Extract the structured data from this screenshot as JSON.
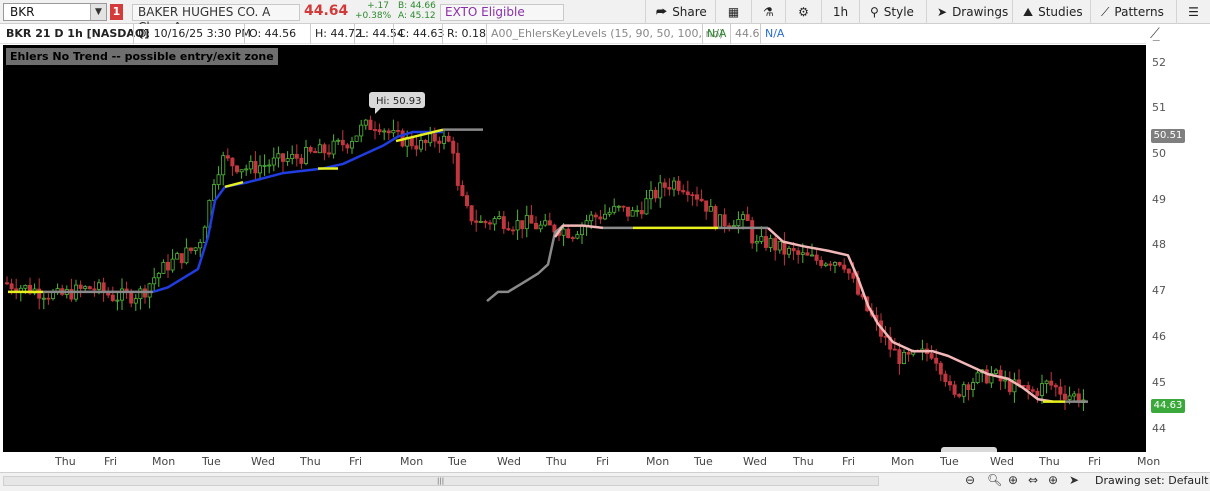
{
  "symbol": {
    "value": "BKR",
    "link_badge": "1"
  },
  "quote": {
    "company": "BAKER HUGHES CO. A Class A",
    "last": "44.64",
    "change": "+.17",
    "change_pct": "+0.38%",
    "bid": "B: 44.66",
    "ask": "A: 45.12",
    "exto": "EXTO Eligible"
  },
  "toolbar": {
    "share": "Share",
    "timeframe": "1h",
    "style": "Style",
    "drawings": "Drawings",
    "studies": "Studies",
    "patterns": "Patterns"
  },
  "info": {
    "title": "BKR 21 D 1h [NASDAQ]",
    "date": "D: 10/16/25 3:30 PM",
    "open": "O: 44.56",
    "high": "H: 44.72",
    "low": "L: 44.54",
    "close": "C: 44.63",
    "range": "R: 0.18",
    "study": "A00_EhlersKeyLevels (15, 90, 50, 100, no)",
    "study_v1": "N/A",
    "study_v2": "44.6",
    "study_v3": "N/A"
  },
  "chart": {
    "banner": "Ehlers No Trend -- possible entry/exit zone",
    "hi_label": "Hi: 50.93",
    "price_tag_upper": "50.51",
    "price_tag_last": "44.63",
    "y_ticks": [
      "52",
      "51",
      "50",
      "49",
      "48",
      "47",
      "46",
      "45",
      "44"
    ],
    "x_ticks": [
      "Thu",
      "Fri",
      "Mon",
      "Tue",
      "Wed",
      "Thu",
      "Fri",
      "Mon",
      "Tue",
      "Wed",
      "Thu",
      "Fri",
      "Mon",
      "Tue",
      "Wed",
      "Thu",
      "Fri",
      "Mon",
      "Tue",
      "Wed",
      "Thu",
      "Fri",
      "Mon"
    ],
    "colors": {
      "up": "#4fb83a",
      "down": "#c2363f",
      "blue": "#1f3de0",
      "yellow": "#e8f01e",
      "pink": "#f2b8b8",
      "gray": "#8a8a8a"
    }
  },
  "bottom": {
    "drawing_set": "Drawing set: Default"
  }
}
